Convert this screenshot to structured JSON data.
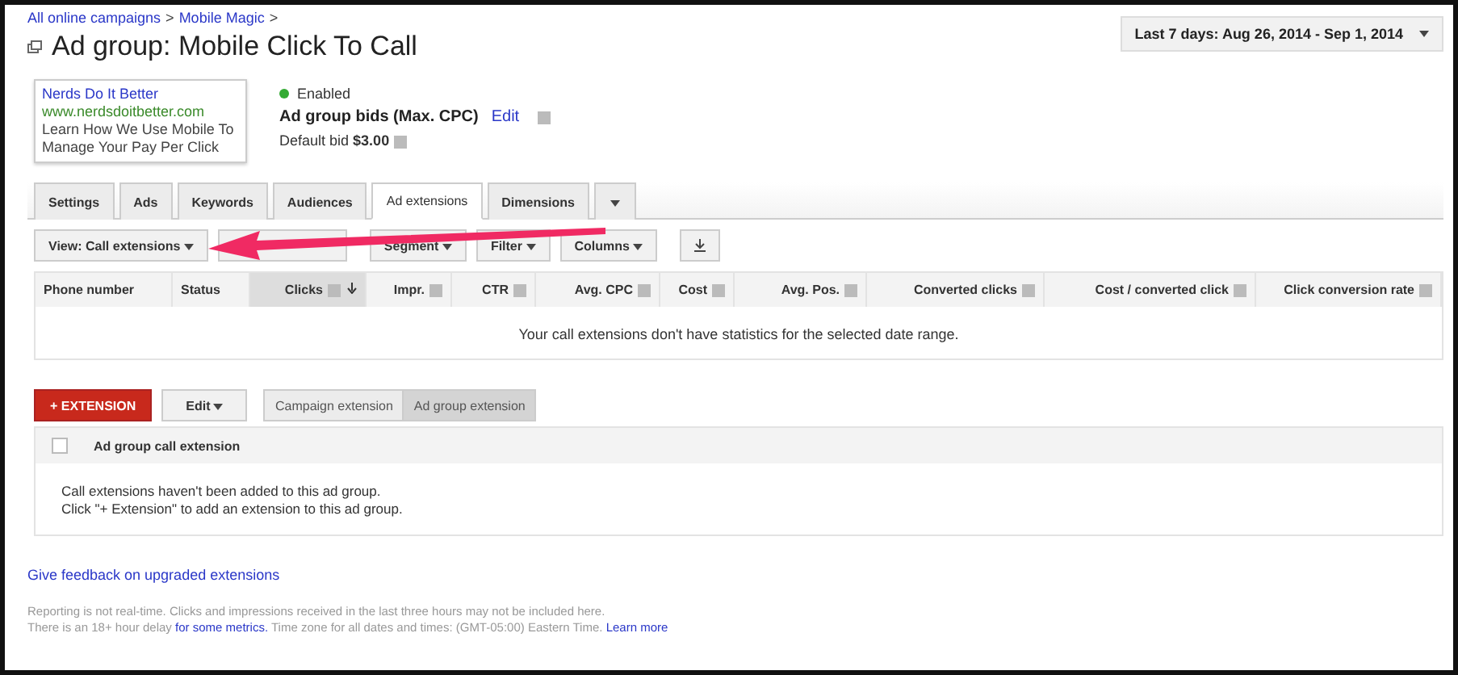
{
  "breadcrumbs": [
    {
      "label": "All online campaigns"
    },
    {
      "label": "Mobile Magic"
    }
  ],
  "separator": ">",
  "title": "Ad group: Mobile Click To Call",
  "date_range": "Last 7 days: Aug 26, 2014 - Sep 1, 2014",
  "ad_preview": {
    "headline": "Nerds Do It Better",
    "url": "www.nerdsdoitbetter.com",
    "lines": [
      "Learn How We Use Mobile To",
      "Manage Your Pay Per Click"
    ]
  },
  "status": {
    "label": "Enabled",
    "enabled": true
  },
  "bids": {
    "label": "Ad group bids (Max. CPC)",
    "edit": "Edit",
    "default_label": "Default bid",
    "default_value": "$3.00"
  },
  "tabs": [
    {
      "label": "Settings",
      "selected": false
    },
    {
      "label": "Ads",
      "selected": false
    },
    {
      "label": "Keywords",
      "selected": false
    },
    {
      "label": "Audiences",
      "selected": false
    },
    {
      "label": "Ad extensions",
      "selected": true
    },
    {
      "label": "Dimensions",
      "selected": false
    }
  ],
  "toolbar": [
    {
      "kind": "dropdown",
      "label": "View: Call extensions"
    },
    {
      "kind": "blank"
    },
    {
      "kind": "dropdown",
      "label": "Segment"
    },
    {
      "kind": "dropdown",
      "label": "Filter"
    },
    {
      "kind": "dropdown",
      "label": "Columns"
    },
    {
      "kind": "download"
    }
  ],
  "table": {
    "columns": [
      {
        "label": "Phone number",
        "help": false,
        "sorted": false
      },
      {
        "label": "Status",
        "help": false,
        "sorted": false
      },
      {
        "label": "Clicks",
        "help": true,
        "sorted": true
      },
      {
        "label": "Impr.",
        "help": true,
        "sorted": false
      },
      {
        "label": "CTR",
        "help": true,
        "sorted": false
      },
      {
        "label": "Avg. CPC",
        "help": true,
        "sorted": false
      },
      {
        "label": "Cost",
        "help": true,
        "sorted": false
      },
      {
        "label": "Avg. Pos.",
        "help": true,
        "sorted": false
      },
      {
        "label": "Converted clicks",
        "help": true,
        "sorted": false
      },
      {
        "label": "Cost / converted click",
        "help": true,
        "sorted": false
      },
      {
        "label": "Click conversion rate",
        "help": true,
        "sorted": false
      }
    ],
    "empty_message": "Your call extensions don't have statistics for the selected date range."
  },
  "extension_bar": {
    "add": "EXTENSION",
    "add_sign": "+",
    "edit": "Edit",
    "levels": [
      {
        "label": "Campaign extension",
        "selected": false
      },
      {
        "label": "Ad group extension",
        "selected": true
      }
    ]
  },
  "extension_table": {
    "checked": false,
    "column": "Ad group call extension",
    "empty_lines": [
      "Call extensions haven't been added to this ad group.",
      "Click \"+ Extension\" to add an extension to this ad group."
    ]
  },
  "feedback_link": "Give feedback on upgraded extensions",
  "footer": {
    "line1": "Reporting is not real-time. Clicks and impressions received in the last three hours may not be included here.",
    "line2_start": "There is an 18+ hour delay",
    "line2_link": "for some metrics.",
    "line2_mid": "Time zone for all dates and times: (GMT-05:00) Eastern Time.",
    "line2_end_link": "Learn more"
  }
}
